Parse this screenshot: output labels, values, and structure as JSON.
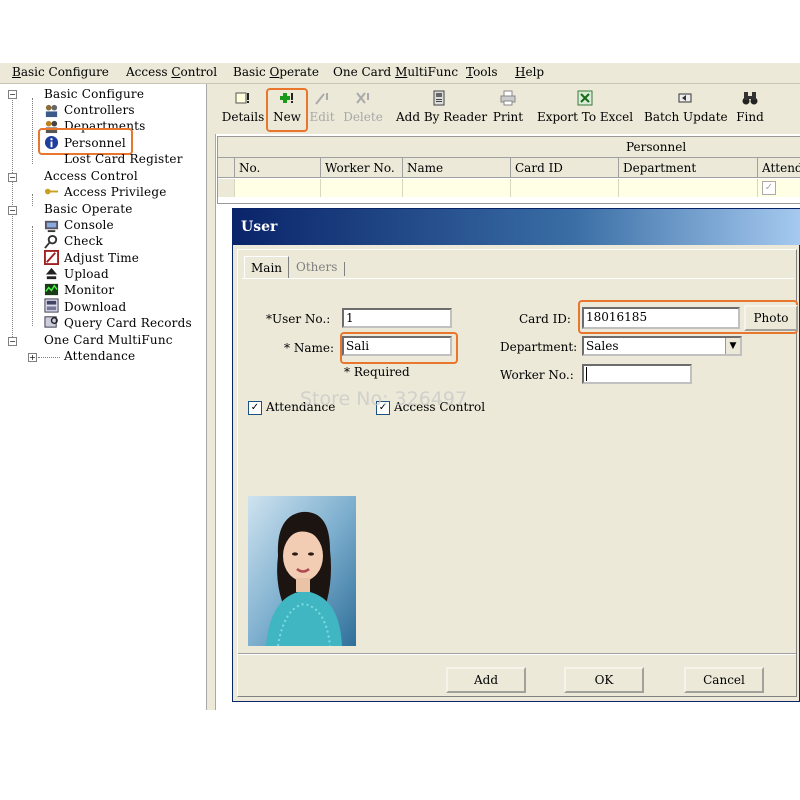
{
  "menu": [
    {
      "pre": "",
      "u": "B",
      "post": "asic Configure"
    },
    {
      "pre": "Access ",
      "u": "C",
      "post": "ontrol"
    },
    {
      "pre": "Basic ",
      "u": "O",
      "post": "perate"
    },
    {
      "pre": "One Card ",
      "u": "M",
      "post": "ultiFunc"
    },
    {
      "pre": "",
      "u": "T",
      "post": "ools"
    },
    {
      "pre": "",
      "u": "H",
      "post": "elp"
    }
  ],
  "tree": {
    "basic_configure": "Basic Configure",
    "controllers": "Controllers",
    "departments": "Departments",
    "personnel": "Personnel",
    "lost_card": "Lost Card Register",
    "access_control": "Access Control",
    "access_privilege": "Access Privilege",
    "basic_operate": "Basic Operate",
    "console": "Console",
    "check": "Check",
    "adjust_time": "Adjust Time",
    "upload": "Upload",
    "monitor": "Monitor",
    "download": "Download",
    "query_card": "Query Card Records",
    "one_card": "One Card MultiFunc",
    "attendance": "Attendance"
  },
  "toolbar": {
    "details": "Details",
    "new": "New",
    "edit": "Edit",
    "delete": "Delete",
    "add_by_reader": "Add By Reader",
    "print": "Print",
    "export_excel": "Export To Excel",
    "batch_update": "Batch Update",
    "find": "Find"
  },
  "grid": {
    "title": "Personnel",
    "columns": [
      "No.",
      "Worker No.",
      "Name",
      "Card ID",
      "Department",
      "Attend"
    ]
  },
  "dialog": {
    "title": "User",
    "tabs": [
      "Main",
      "Others"
    ],
    "user_no_label": "*User No.:",
    "user_no_value": "1",
    "name_label": "* Name:",
    "name_value": "Sali",
    "required_label": "*  Required",
    "card_id_label": "Card ID:",
    "card_id_value": "18016185",
    "photo_button": "Photo",
    "department_label": "Department:",
    "department_value": "Sales",
    "worker_no_label": "Worker No.:",
    "worker_no_value": "",
    "attendance_label": "Attendance",
    "access_control_label": "Access Control",
    "add_button": "Add",
    "ok_button": "OK",
    "cancel_button": "Cancel"
  },
  "watermark": "Store No: 326497",
  "colors": {
    "highlight": "#e8762d",
    "title_bar": "#0a246a",
    "chrome": "#ece9d8"
  }
}
